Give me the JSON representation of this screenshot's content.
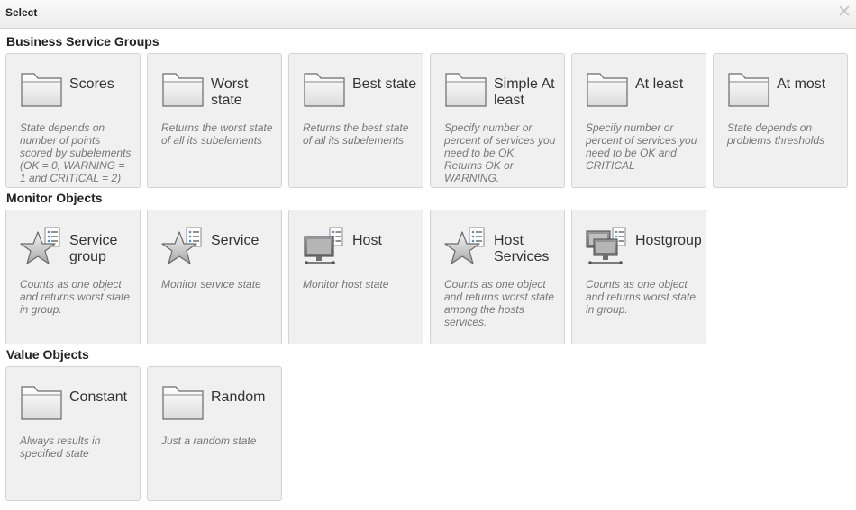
{
  "dialog": {
    "title": "Select"
  },
  "sections": [
    {
      "title": "Business Service Groups",
      "items": [
        {
          "label": "Scores",
          "icon": "folder-icon",
          "desc": "State depends on number of points scored by subelements (OK = 0, WARNING = 1 and CRITICAL = 2)"
        },
        {
          "label": "Worst state",
          "icon": "folder-icon",
          "desc": "Returns the worst state of all its subelements"
        },
        {
          "label": "Best state",
          "icon": "folder-icon",
          "desc": "Returns the best state of all its subelements"
        },
        {
          "label": "Simple At least",
          "icon": "folder-icon",
          "desc": "Specify number or percent of services you need to be OK. Returns OK or WARNING."
        },
        {
          "label": "At least",
          "icon": "folder-icon",
          "desc": "Specify number or percent of services you need to be OK and CRITICAL"
        },
        {
          "label": "At most",
          "icon": "folder-icon",
          "desc": "State depends on problems thresholds"
        }
      ]
    },
    {
      "title": "Monitor Objects",
      "items": [
        {
          "label": "Service group",
          "icon": "service-group-icon",
          "desc": "Counts as one object and returns worst state in group."
        },
        {
          "label": "Service",
          "icon": "service-icon",
          "desc": "Monitor service state"
        },
        {
          "label": "Host",
          "icon": "host-icon",
          "desc": "Monitor host state"
        },
        {
          "label": "Host Services",
          "icon": "host-services-icon",
          "desc": "Counts as one object and returns worst state among the hosts services."
        },
        {
          "label": "Hostgroup",
          "icon": "hostgroup-icon",
          "desc": "Counts as one object and returns worst state in group."
        }
      ]
    },
    {
      "title": "Value Objects",
      "items": [
        {
          "label": "Constant",
          "icon": "folder-icon",
          "desc": "Always results in specified state"
        },
        {
          "label": "Random",
          "icon": "folder-icon",
          "desc": "Just a random state"
        }
      ]
    }
  ]
}
